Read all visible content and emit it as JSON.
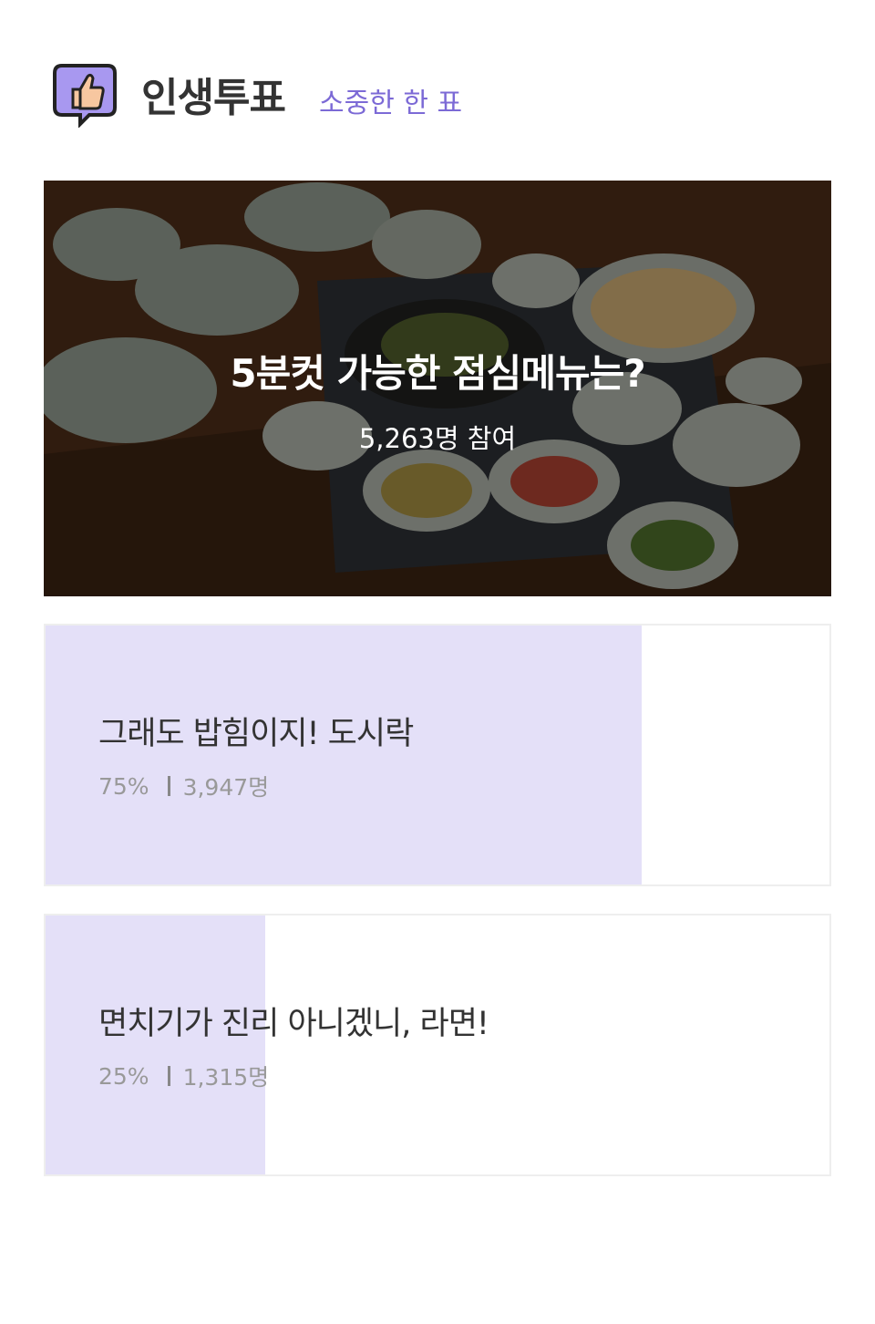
{
  "header": {
    "logo_icon": "thumbs-up-speech-bubble-icon",
    "title": "인생투표",
    "subtitle": "소중한 한 표",
    "accent_color": "#7c6ad6"
  },
  "poll": {
    "question": "5분컷 가능한 점심메뉴는?",
    "participants": "5,263명 참여",
    "image_description_icon": "korean-table-meal-photo",
    "options": [
      {
        "label": "그래도 밥힘이지! 도시락",
        "percent_text": "75%",
        "count_text": "3,947명",
        "fill_fraction": 0.76
      },
      {
        "label": "면치기가 진리 아니겠니, 라면!",
        "percent_text": "25%",
        "count_text": "1,315명",
        "fill_fraction": 0.28
      }
    ],
    "fill_color": "#e4e0f8"
  }
}
